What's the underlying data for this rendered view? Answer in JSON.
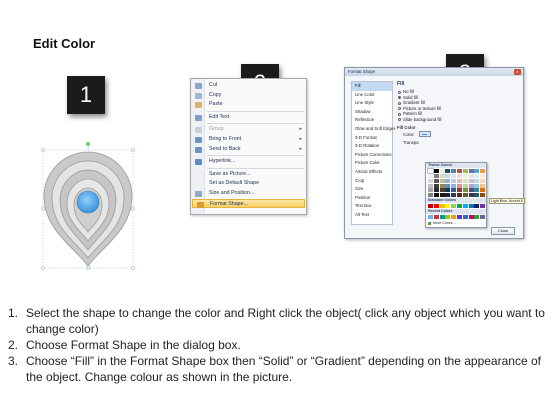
{
  "title": "Edit Color",
  "badges": [
    "1",
    "2",
    "3"
  ],
  "context_menu": {
    "items": [
      {
        "label": "Cut",
        "icon": "scissors-icon",
        "state": "normal",
        "submenu": false
      },
      {
        "label": "Copy",
        "icon": "copy-icon",
        "state": "normal",
        "submenu": false
      },
      {
        "label": "Paste",
        "icon": "paste-icon",
        "state": "normal",
        "submenu": false
      },
      {
        "label": "Edit Text",
        "icon": "edit-text-icon",
        "state": "normal",
        "submenu": false
      },
      {
        "label": "Group",
        "icon": "group-icon",
        "state": "disabled",
        "submenu": true
      },
      {
        "label": "Bring to Front",
        "icon": "bring-front-icon",
        "state": "normal",
        "submenu": true
      },
      {
        "label": "Send to Back",
        "icon": "send-back-icon",
        "state": "normal",
        "submenu": true
      },
      {
        "label": "Hyperlink...",
        "icon": "hyperlink-icon",
        "state": "normal",
        "submenu": false
      },
      {
        "label": "Save as Picture...",
        "icon": "",
        "state": "normal",
        "submenu": false
      },
      {
        "label": "Set as Default Shape",
        "icon": "",
        "state": "normal",
        "submenu": false
      },
      {
        "label": "Size and Position...",
        "icon": "size-icon",
        "state": "normal",
        "submenu": false
      },
      {
        "label": "Format Shape...",
        "icon": "format-shape-icon",
        "state": "highlighted",
        "submenu": false
      }
    ]
  },
  "format_dialog": {
    "title": "Format Shape",
    "close_glyph": "x",
    "sidebar": [
      "Fill",
      "Line Color",
      "Line Style",
      "Shadow",
      "Reflection",
      "Glow and Soft Edges",
      "3-D Format",
      "3-D Rotation",
      "Picture Corrections",
      "Picture Color",
      "Artistic Effects",
      "Crop",
      "Size",
      "Position",
      "Text Box",
      "Alt Text"
    ],
    "selected_index": 0,
    "main_header": "Fill",
    "fill_options": [
      {
        "label": "No fill",
        "on": false
      },
      {
        "label": "Solid fill",
        "on": true
      },
      {
        "label": "Gradient fill",
        "on": false
      },
      {
        "label": "Picture or texture fill",
        "on": false
      },
      {
        "label": "Pattern fill",
        "on": false
      },
      {
        "label": "Slide background fill",
        "on": false
      }
    ],
    "fill_color_label": "Fill Color",
    "color_label": "Color:",
    "transparency_label": "Transpa",
    "palette": {
      "theme_header": "Theme Colors",
      "standard_header": "Standard Colors",
      "recent_header": "Recent Colors",
      "more_label": "More Colors...",
      "tooltip": "Light Blue, Accent 5",
      "theme_top": [
        "#ffffff",
        "#000000",
        "#eeece1",
        "#1f497d",
        "#4f81bd",
        "#c0504d",
        "#9bbb59",
        "#8064a2",
        "#4bacc6",
        "#f79646"
      ],
      "theme_rows": [
        [
          "#f2f2f2",
          "#7f7f7f",
          "#ddd9c3",
          "#c6d9f0",
          "#dbe5f1",
          "#f2dcdb",
          "#ebf1dd",
          "#e5e0ec",
          "#dbeef3",
          "#fdeada"
        ],
        [
          "#d8d8d8",
          "#595959",
          "#c4bd97",
          "#8db3e2",
          "#b8cce4",
          "#e5b9b7",
          "#d7e3bc",
          "#ccc1d9",
          "#b7dde8",
          "#fbd5b5"
        ],
        [
          "#bfbfbf",
          "#3f3f3f",
          "#938953",
          "#548dd4",
          "#95b3d7",
          "#d99694",
          "#c3d69b",
          "#b2a2c7",
          "#92cddc",
          "#fac08f"
        ],
        [
          "#a5a5a5",
          "#262626",
          "#494429",
          "#17365d",
          "#366092",
          "#953734",
          "#76923c",
          "#5f497a",
          "#31859b",
          "#e36c09"
        ],
        [
          "#7f7f7f",
          "#0c0c0c",
          "#1d1b10",
          "#0f243e",
          "#244061",
          "#632423",
          "#4f6128",
          "#3f3151",
          "#205867",
          "#974806"
        ]
      ],
      "standard": [
        "#c00000",
        "#ff0000",
        "#ffc000",
        "#ffff00",
        "#92d050",
        "#00b050",
        "#00b0f0",
        "#0070c0",
        "#002060",
        "#7030a0"
      ],
      "recent": [
        "#66b2ff",
        "#cc3333",
        "#009999",
        "#99cc00",
        "#ff9900",
        "#6633cc",
        "#3366cc",
        "#cc0066",
        "#339933",
        "#666699"
      ]
    },
    "close_button": "Close"
  },
  "steps": [
    {
      "num": "1.",
      "text": "Select the shape to change the color and Right click the object( click any object which you want to change color)"
    },
    {
      "num": "2.",
      "text": "Choose Format Shape in the dialog box."
    },
    {
      "num": "3.",
      "text": "Choose “Fill” in the Format Shape box then “Solid” or “Gradient” depending on the appearance of the object. Change colour as shown in the picture."
    }
  ],
  "colors": {
    "accent_fill": "#5aa9e6",
    "badge_bg": "#1b1b1b",
    "menu_highlight": "#f8cf62"
  }
}
